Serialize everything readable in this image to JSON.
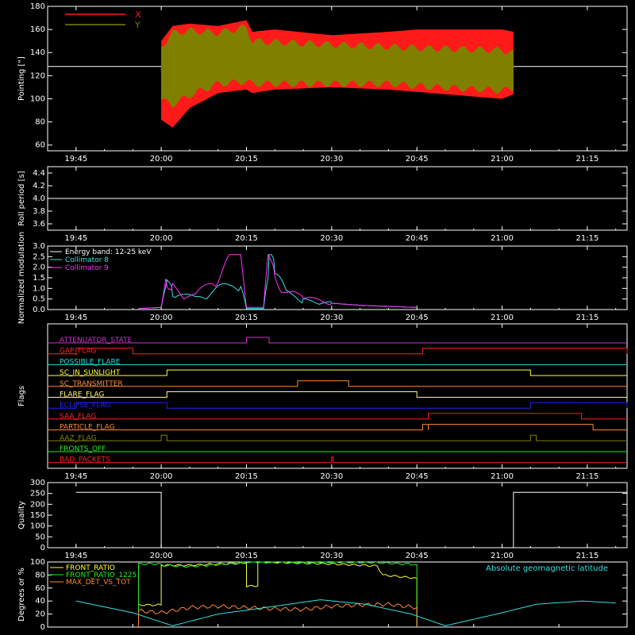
{
  "colors": {
    "background": "#000000",
    "axes": "#ffffff",
    "x_series": "#ff1a1a",
    "y_series": "#808000",
    "cyan": "#33e0e0",
    "magenta": "#ff33ff",
    "green": "#22ee22",
    "yellow": "#ffff33",
    "orange": "#ff8833",
    "blue": "#2222ff",
    "purple": "#cc33cc"
  },
  "chart_data": [
    {
      "type": "area",
      "ylabel": "Pointing [\"]",
      "ylim": [
        55,
        180
      ],
      "yticks": [
        60,
        80,
        100,
        120,
        140,
        160,
        180
      ],
      "xlabels": [
        "19:45",
        "20:00",
        "20:15",
        "20:30",
        "20:45",
        "21:00",
        "21:15"
      ],
      "reference_line": 128,
      "legend": [
        "X",
        "Y"
      ],
      "legend_placement": "top-left",
      "time_range": [
        "20:00",
        "21:02"
      ],
      "series": [
        {
          "name": "X",
          "time": [
            "20:00",
            "20:02",
            "20:05",
            "20:10",
            "20:15",
            "20:16",
            "20:20",
            "20:30",
            "20:40",
            "20:45",
            "21:00",
            "21:02"
          ],
          "upper": [
            150,
            163,
            165,
            163,
            168,
            158,
            160,
            155,
            158,
            160,
            160,
            158
          ],
          "lower": [
            82,
            75,
            92,
            105,
            108,
            105,
            108,
            110,
            108,
            106,
            100,
            104
          ]
        },
        {
          "name": "Y",
          "time": [
            "20:00",
            "20:02",
            "20:05",
            "20:10",
            "20:15",
            "20:16",
            "20:20",
            "20:30",
            "20:40",
            "20:45",
            "21:00",
            "21:02"
          ],
          "upper": [
            148,
            160,
            162,
            160,
            165,
            153,
            152,
            150,
            148,
            147,
            145,
            143
          ],
          "lower": [
            96,
            92,
            100,
            110,
            112,
            110,
            110,
            110,
            110,
            108,
            104,
            106
          ]
        }
      ]
    },
    {
      "type": "line",
      "ylabel": "Roll period [s]",
      "ylim": [
        3.5,
        4.5
      ],
      "yticks": [
        "3.6",
        "3.8",
        "4.0",
        "4.2",
        "4.4"
      ],
      "xlabels": [
        "19:45",
        "20:00",
        "20:15",
        "20:30",
        "20:45",
        "21:00",
        "21:15"
      ],
      "reference_line": 4.0
    },
    {
      "type": "line",
      "ylabel": "Normalized modulation",
      "ylim": [
        0,
        3.0
      ],
      "yticks": [
        "0.0",
        "0.5",
        "1.0",
        "1.5",
        "2.0",
        "2.5",
        "3.0"
      ],
      "xlabels": [
        "19:45",
        "20:00",
        "20:15",
        "20:30",
        "20:45",
        "21:00",
        "21:15"
      ],
      "legend": [
        "Energy band: 12-25 keV",
        "Collimator 8",
        "Collimator 9"
      ],
      "legend_placement": "top-left",
      "series": [
        {
          "name": "Collimator 8",
          "time": [
            "19:56",
            "20:00",
            "20:01",
            "20:02",
            "20:04",
            "20:06",
            "20:08",
            "20:10",
            "20:12",
            "20:14",
            "20:15",
            "20:16",
            "20:18",
            "20:19",
            "20:20",
            "20:22",
            "20:25",
            "20:30",
            "20:35",
            "20:40",
            "20:45"
          ],
          "values": [
            0.05,
            0.1,
            1.2,
            0.8,
            0.6,
            0.5,
            0.7,
            0.9,
            1.0,
            1.3,
            0.05,
            0.05,
            0.05,
            2.2,
            1.8,
            0.7,
            0.4,
            0.3,
            0.2,
            0.15,
            0.1
          ]
        },
        {
          "name": "Collimator 9",
          "time": [
            "19:56",
            "20:00",
            "20:01",
            "20:02",
            "20:04",
            "20:06",
            "20:08",
            "20:10",
            "20:12",
            "20:14",
            "20:15",
            "20:16",
            "20:18",
            "20:19",
            "20:20",
            "20:22",
            "20:25",
            "20:30",
            "20:35",
            "20:40",
            "20:45"
          ],
          "values": [
            0.05,
            0.1,
            1.4,
            1.0,
            0.7,
            0.6,
            1.0,
            1.6,
            2.1,
            2.6,
            0.1,
            0.1,
            0.1,
            2.6,
            1.5,
            0.8,
            0.5,
            0.3,
            0.2,
            0.15,
            0.1
          ]
        }
      ]
    },
    {
      "type": "line",
      "ylabel": "Flags",
      "xlabels": [
        "19:45",
        "20:00",
        "20:15",
        "20:30",
        "20:45",
        "21:00",
        "21:15"
      ],
      "flags": [
        {
          "name": "ATTENUATOR_STATE",
          "color": "#cc33cc",
          "transitions": [
            [
              "20:15",
              "20:19"
            ]
          ]
        },
        {
          "name": "GAP_FLAG",
          "color": "#ff2222",
          "transitions": [
            [
              "19:45",
              "19:55"
            ],
            [
              "20:46",
              "21:22"
            ]
          ]
        },
        {
          "name": "POSSIBLE_FLARE",
          "color": "#22dddd",
          "transitions": []
        },
        {
          "name": "SC_IN_SUNLIGHT",
          "color": "#ffff33",
          "transitions": [
            [
              "20:01",
              "21:05"
            ]
          ]
        },
        {
          "name": "SC_TRANSMITTER",
          "color": "#ff8833",
          "transitions": [
            [
              "20:24",
              "20:33"
            ]
          ]
        },
        {
          "name": "FLARE_FLAG",
          "color": "#ffff66",
          "transitions": [
            [
              "20:01",
              "20:45"
            ]
          ]
        },
        {
          "name": "ECLIPSE_FLAG",
          "color": "#2222ff",
          "transitions": [
            [
              "19:45",
              "20:01"
            ],
            [
              "21:05",
              "21:22"
            ]
          ]
        },
        {
          "name": "SAA_FLAG",
          "color": "#ff2222",
          "transitions": [
            [
              "20:47",
              "21:14"
            ]
          ]
        },
        {
          "name": "PARTICLE_FLAG",
          "color": "#ff8833",
          "transitions": [
            [
              "20:46",
              "20:47"
            ],
            [
              "20:47",
              "21:16"
            ]
          ]
        },
        {
          "name": "AAZ_FLAG",
          "color": "#808000",
          "transitions": [
            [
              "20:00",
              "20:01"
            ],
            [
              "21:05",
              "21:06"
            ]
          ]
        },
        {
          "name": "FRONTS_OFF",
          "color": "#22ee22",
          "transitions": []
        },
        {
          "name": "BAD_PACKETS",
          "color": "#ff2222",
          "transitions": [
            [
              "20:30",
              "20:30"
            ]
          ]
        }
      ]
    },
    {
      "type": "line",
      "ylabel": "Quality",
      "ylim": [
        0,
        300
      ],
      "yticks": [
        0,
        50,
        100,
        150,
        200,
        250,
        300
      ],
      "xlabels": [
        "19:45",
        "20:00",
        "20:15",
        "20:30",
        "20:45",
        "21:00",
        "21:15"
      ],
      "series": [
        {
          "name": "",
          "time": [
            "19:45",
            "20:00",
            "20:00",
            "21:02",
            "21:02",
            "21:22"
          ],
          "values": [
            255,
            255,
            0,
            0,
            255,
            255
          ]
        }
      ]
    },
    {
      "type": "line",
      "ylabel": "Degrees or %",
      "ylim": [
        0,
        100
      ],
      "yticks": [
        0,
        20,
        40,
        60,
        80,
        100
      ],
      "legend": [
        "FRONT_RATIO",
        "FRONT_RATIO_1225",
        "MAX_DET_VS_TOT"
      ],
      "legend_placement": "top-left",
      "annotation": "Absolute geomagnetic latitude",
      "series": [
        {
          "name": "FRONT_RATIO",
          "time": [
            "19:56",
            "19:56",
            "20:00",
            "20:00",
            "20:05",
            "20:10",
            "20:15",
            "20:15",
            "20:17",
            "20:17",
            "20:22",
            "20:30",
            "20:38",
            "20:39",
            "20:45",
            "20:45"
          ],
          "values": [
            0,
            34,
            34,
            95,
            95,
            97,
            98,
            63,
            63,
            100,
            99,
            97,
            94,
            80,
            75,
            0
          ]
        },
        {
          "name": "FRONT_RATIO_1225",
          "time": [
            "19:56",
            "19:56",
            "20:00",
            "20:00",
            "20:05",
            "20:10",
            "20:15",
            "20:20",
            "20:30",
            "20:38",
            "20:45",
            "20:45"
          ],
          "values": [
            0,
            97,
            97,
            95,
            93,
            96,
            100,
            100,
            100,
            99,
            96,
            0
          ]
        },
        {
          "name": "MAX_DET_VS_TOT",
          "time": [
            "19:56",
            "19:56",
            "20:00",
            "20:05",
            "20:10",
            "20:15",
            "20:20",
            "20:25",
            "20:30",
            "20:35",
            "20:40",
            "20:45",
            "20:45"
          ],
          "values": [
            0,
            25,
            22,
            30,
            32,
            30,
            28,
            27,
            32,
            34,
            35,
            30,
            0
          ]
        },
        {
          "name": "Absolute geomagnetic latitude",
          "time": [
            "19:45",
            "19:55",
            "20:02",
            "20:10",
            "20:20",
            "20:28",
            "20:36",
            "20:44",
            "20:50",
            "21:00",
            "21:06",
            "21:14",
            "21:20"
          ],
          "values": [
            40,
            22,
            2,
            20,
            32,
            42,
            35,
            20,
            2,
            22,
            35,
            40,
            37
          ]
        }
      ]
    }
  ]
}
